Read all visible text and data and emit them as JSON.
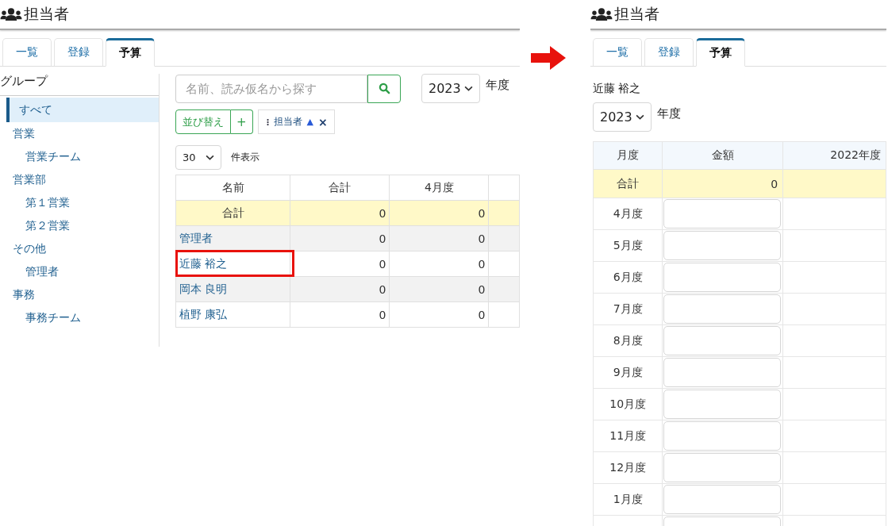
{
  "before": {
    "title": "担当者",
    "tabs": [
      {
        "label": "一覧",
        "selected": false
      },
      {
        "label": "登録",
        "selected": false
      },
      {
        "label": "予算",
        "selected": true
      }
    ],
    "sidebar": {
      "title": "グループ",
      "items": [
        {
          "label": "すべて",
          "selected": true
        },
        {
          "label": "営業",
          "selected": false,
          "children": [
            {
              "label": "営業チーム",
              "selected": false
            }
          ]
        },
        {
          "label": "営業部",
          "selected": false,
          "children": [
            {
              "label": "第１営業",
              "selected": false
            },
            {
              "label": "第２営業",
              "selected": false
            }
          ]
        },
        {
          "label": "その他",
          "selected": false,
          "children": [
            {
              "label": "管理者",
              "selected": false
            }
          ]
        },
        {
          "label": "事務",
          "selected": false,
          "children": [
            {
              "label": "事務チーム",
              "selected": false
            }
          ]
        }
      ]
    },
    "search": {
      "placeholder": "名前、読み仮名から探す"
    },
    "year_select": {
      "value": "2023",
      "label": "年度"
    },
    "sort": {
      "label": "並び替え",
      "add": "+",
      "chips": [
        {
          "label": "担当者",
          "direction": "▲",
          "remove": "×"
        }
      ]
    },
    "per_page": {
      "value": "30",
      "label": "件表示"
    },
    "table": {
      "columns": [
        "名前",
        "合計",
        "4月度"
      ],
      "total": {
        "label": "合計",
        "values": [
          "0",
          "0"
        ]
      },
      "rows": [
        {
          "name": "管理者",
          "values": [
            "0",
            "0"
          ],
          "highlighted": false
        },
        {
          "name": "近藤 裕之",
          "values": [
            "0",
            "0"
          ],
          "highlighted": true
        },
        {
          "name": "岡本 良明",
          "values": [
            "0",
            "0"
          ],
          "highlighted": false
        },
        {
          "name": "植野 康弘",
          "values": [
            "0",
            "0"
          ],
          "highlighted": false
        }
      ]
    }
  },
  "after": {
    "title": "担当者",
    "tabs": [
      {
        "label": "一覧",
        "selected": false
      },
      {
        "label": "登録",
        "selected": false
      },
      {
        "label": "予算",
        "selected": true
      }
    ],
    "person": "近藤 裕之",
    "year_select": {
      "value": "2023",
      "label": "年度"
    },
    "table": {
      "columns": [
        "月度",
        "金額",
        "2022年度"
      ],
      "total": {
        "label": "合計",
        "amount": "0"
      },
      "months": [
        "4月度",
        "5月度",
        "6月度",
        "7月度",
        "8月度",
        "9月度",
        "10月度",
        "11月度",
        "12月度",
        "1月度"
      ]
    }
  }
}
